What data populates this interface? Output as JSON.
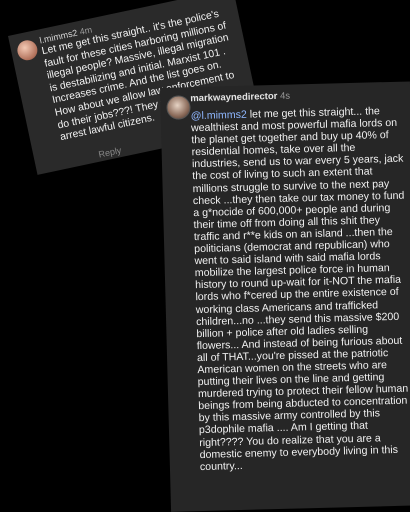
{
  "comment1": {
    "username": "l.mimms2",
    "time": "4m",
    "text": "Let me get this straight.. it's the police's fault for these cities harboring millions of illegal people? Massive, illegal migration is destabilizing and initial. Marxist 101 . Increases crime. And the list goes on. How about we allow law enforcement to do their jobs???! They weren't there to arrest lawful citizens.",
    "reply_label": "Reply"
  },
  "comment2": {
    "username": "markwaynedirector",
    "time": "4s",
    "mention": "@l.mimms2",
    "text": " let me get this straight... the wealthiest and most powerful mafia lords on the planet get together and buy up 40% of residential homes, take over all the industries, send us to war every 5 years, jack the cost of living to such an extent that millions struggle to survive to the next pay check ...they then take our tax money to fund a g*nocide of 600,000+ people and during their time off from doing all this shit they traffic and r**e kids on an island ...then the politicians (democrat and republican) who went to said island with said mafia lords mobilize the largest police force in human history to round up-wait for it-NOT the mafia lords who f*cered up the entire existence of working class Americans and trafficked children...no ...they send this massive $200 billion + police after old ladies selling flowers... And instead of being furious about all of THAT...you're pissed at the patriotic American women on the streets who are putting their lives on the line and getting murdered trying to protect their fellow human beings from being abducted to concentration by this massive army controlled by this p3dophile mafia  ....  Am I getting that right????  You do realize that you are a domestic enemy to everybody living in this country..."
  }
}
